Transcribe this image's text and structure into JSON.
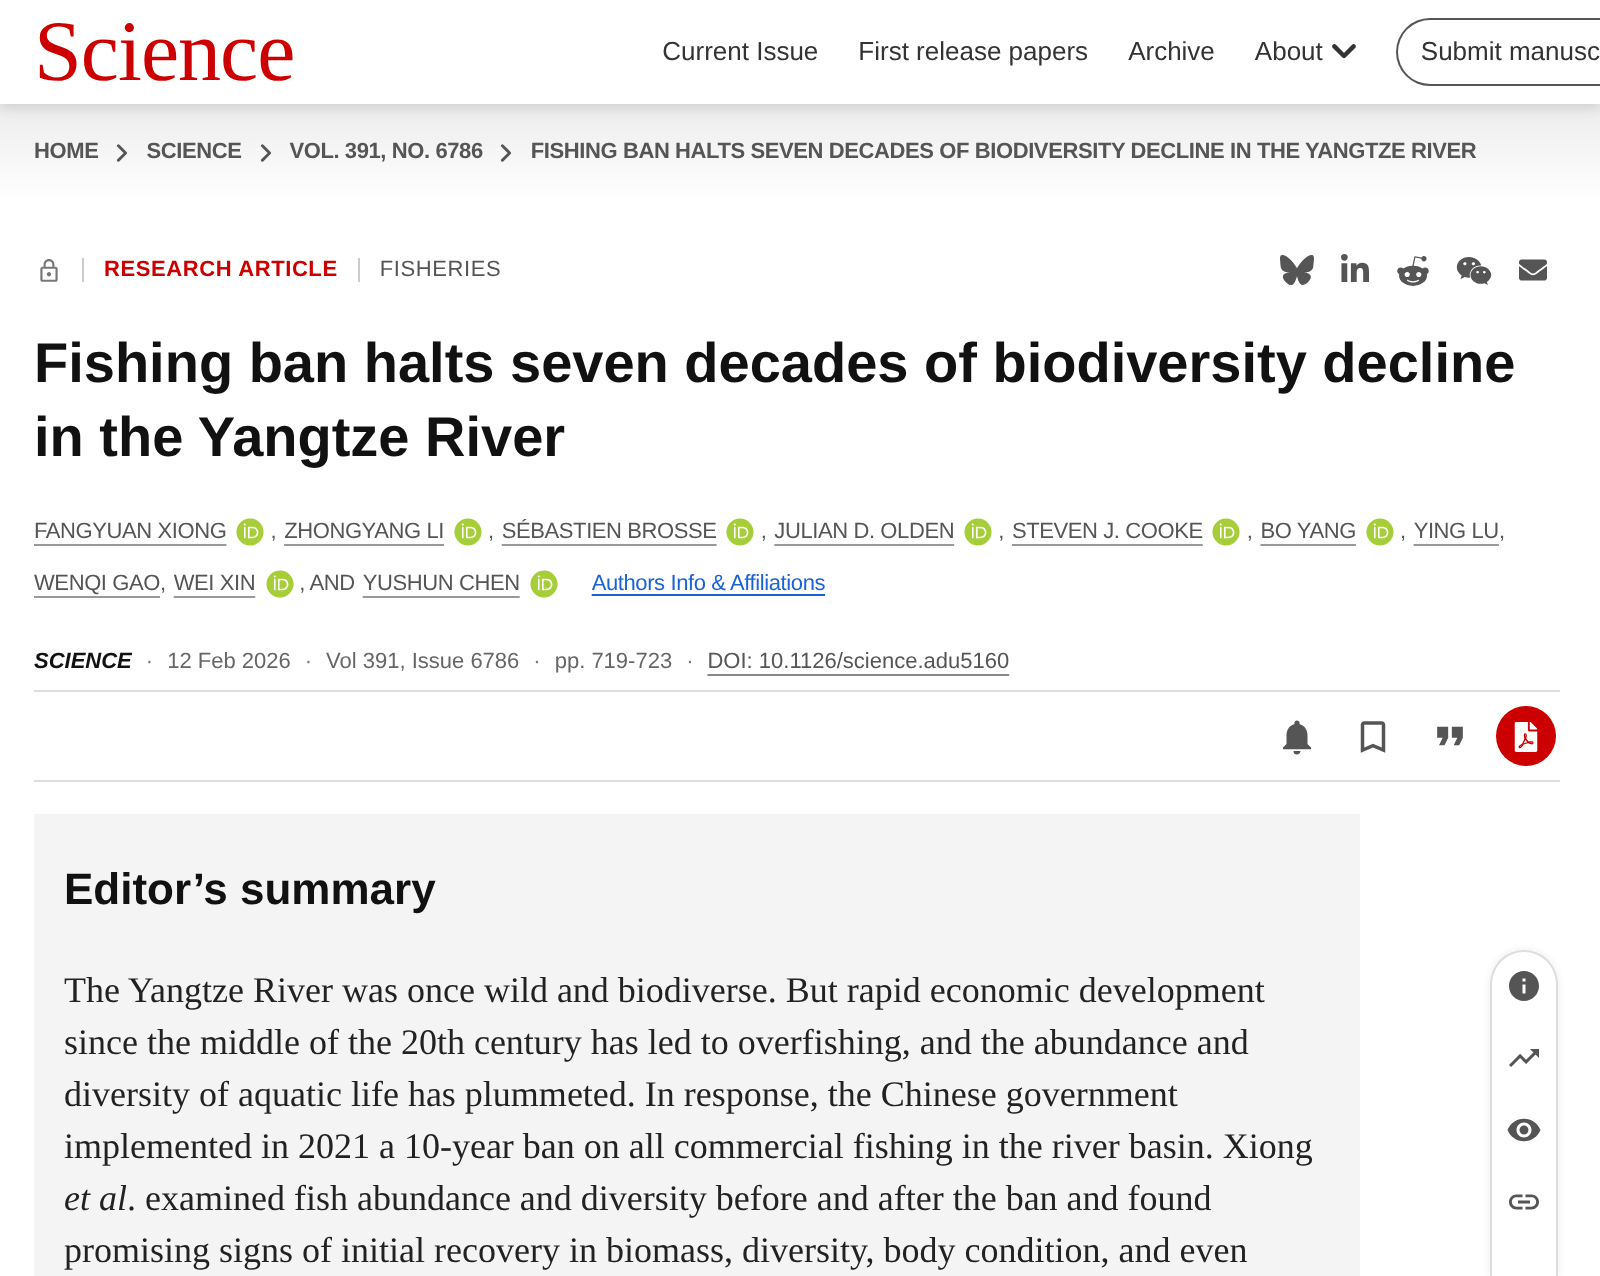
{
  "header": {
    "logo": "Science",
    "nav": [
      {
        "label": "Current Issue",
        "has_menu": false
      },
      {
        "label": "First release papers",
        "has_menu": false
      },
      {
        "label": "Archive",
        "has_menu": false
      },
      {
        "label": "About",
        "has_menu": true
      }
    ],
    "submit_button": "Submit manusc"
  },
  "breadcrumb": [
    "HOME",
    "SCIENCE",
    "VOL. 391, NO. 6786",
    "FISHING BAN HALTS SEVEN DECADES OF BIODIVERSITY DECLINE IN THE YANGTZE RIVER"
  ],
  "article": {
    "article_type": "RESEARCH ARTICLE",
    "subject": "FISHERIES",
    "title": "Fishing ban halts seven decades of biodiversity decline in the Yangtze River",
    "authors": [
      {
        "name": "FANGYUAN XIONG",
        "orcid": true,
        "after": ","
      },
      {
        "name": "ZHONGYANG LI",
        "orcid": true,
        "after": ","
      },
      {
        "name": "SÉBASTIEN BROSSE",
        "orcid": true,
        "after": ","
      },
      {
        "name": "JULIAN D. OLDEN",
        "orcid": true,
        "after": ","
      },
      {
        "name": "STEVEN J. COOKE",
        "orcid": true,
        "after": ","
      },
      {
        "name": "BO YANG",
        "orcid": true,
        "after": ","
      },
      {
        "name": "YING LU",
        "orcid": false,
        "after": ","
      },
      {
        "name": "WENQI GAO",
        "orcid": false,
        "after": ","
      },
      {
        "name": "WEI XIN",
        "orcid": true,
        "after": ", AND"
      },
      {
        "name": "YUSHUN CHEN",
        "orcid": true
      }
    ],
    "affiliations_link": "Authors Info & Affiliations",
    "meta": [
      {
        "kind": "journal",
        "text": "SCIENCE"
      },
      {
        "kind": "dot",
        "text": "·"
      },
      {
        "kind": "text",
        "text": "12 Feb 2026"
      },
      {
        "kind": "dot",
        "text": "·"
      },
      {
        "kind": "text",
        "text": "Vol 391, Issue 6786"
      },
      {
        "kind": "dot",
        "text": "·"
      },
      {
        "kind": "text",
        "text": "pp. 719-723"
      },
      {
        "kind": "dot",
        "text": "·"
      },
      {
        "kind": "link",
        "text": "DOI: 10.1126/science.adu5160"
      }
    ]
  },
  "editors_summary": {
    "heading": "Editor’s summary",
    "text": "The Yangtze River was once wild and biodiverse. But rapid economic development since the middle of the 20th century has led to overfishing, and the abundance and diversity of aquatic life has plummeted. In response, the Chinese government implemented in 2021 a 10-year ban on all commercial fishing in the river basin. Xiong *et al*. examined fish abundance and diversity before and after the ban and found promising signs of initial recovery in biomass, diversity, body condition, and even"
  }
}
